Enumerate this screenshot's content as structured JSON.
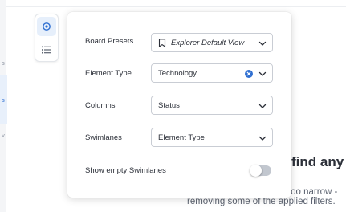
{
  "sidebar": {
    "marks": [
      "s",
      "s",
      "v"
    ],
    "icons": [
      "nav-item-icon",
      "nav-item-icon",
      "nav-item-icon"
    ]
  },
  "view_toggle": {
    "items": [
      {
        "name": "board-view",
        "icon": "gear-icon",
        "active": true
      },
      {
        "name": "list-view",
        "icon": "list-icon",
        "active": false
      }
    ]
  },
  "settings": {
    "board_presets": {
      "label": "Board Presets",
      "value": "Explorer Default View",
      "icon": "bookmark-icon"
    },
    "element_type": {
      "label": "Element Type",
      "value": "Technology",
      "clearable": true
    },
    "columns": {
      "label": "Columns",
      "value": "Status"
    },
    "swimlanes": {
      "label": "Swimlanes",
      "value": "Element Type"
    },
    "show_empty_swimlanes": {
      "label": "Show empty Swimlanes",
      "enabled": false
    }
  },
  "empty_state": {
    "title": "find any e",
    "line1": "s too narrow -",
    "line2": "removing some of the applied filters."
  },
  "colors": {
    "accent": "#2f6fd1",
    "clear_badge": "#2f6fd1",
    "toggle_off": "#c2c7cf"
  }
}
